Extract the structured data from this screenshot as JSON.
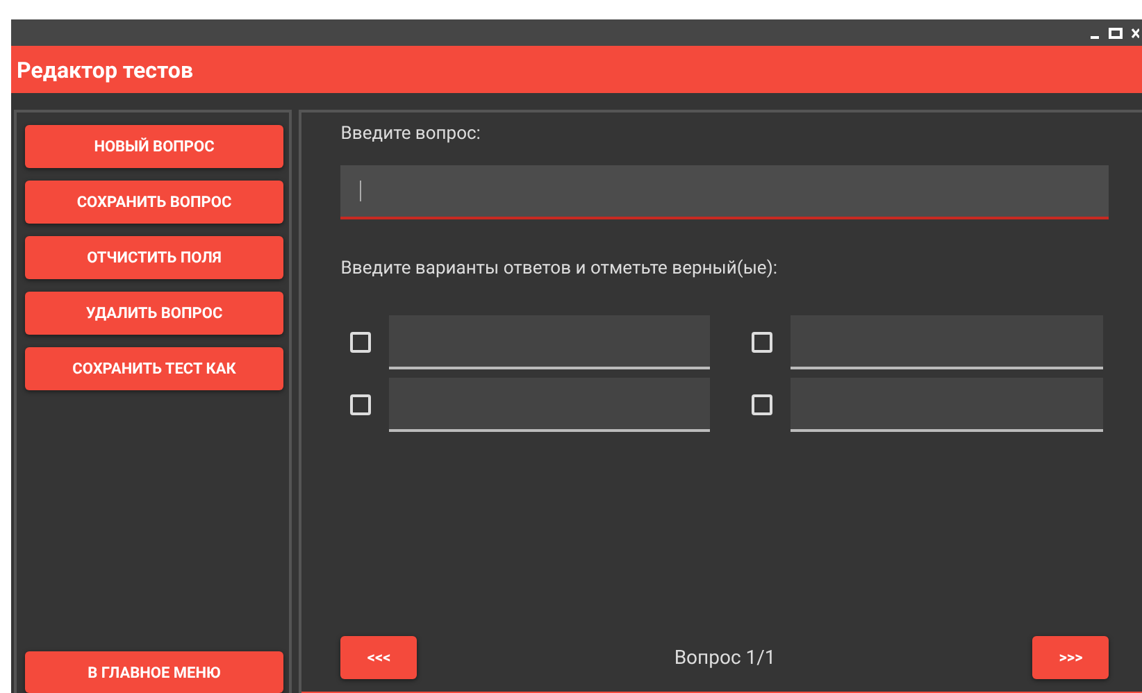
{
  "window": {
    "title": "Редактор тестов"
  },
  "sidebar": {
    "buttons": [
      "НОВЫЙ ВОПРОС",
      "СОХРАНИТЬ ВОПРОС",
      "ОТЧИСТИТЬ ПОЛЯ",
      "УДАЛИТЬ ВОПРОС",
      "СОХРАНИТЬ ТЕСТ КАК"
    ],
    "bottom_button": "В ГЛАВНОЕ МЕНЮ"
  },
  "question": {
    "label": "Введите вопрос:",
    "focused": true
  },
  "answers_label": "Введите варианты ответов и отметьте верный(ые):",
  "answers": [
    {
      "checked": false
    },
    {
      "checked": false
    },
    {
      "checked": false
    },
    {
      "checked": false
    }
  ],
  "navigation": {
    "prev": "<<<",
    "counter": "Вопрос 1/1",
    "next": ">>>"
  }
}
